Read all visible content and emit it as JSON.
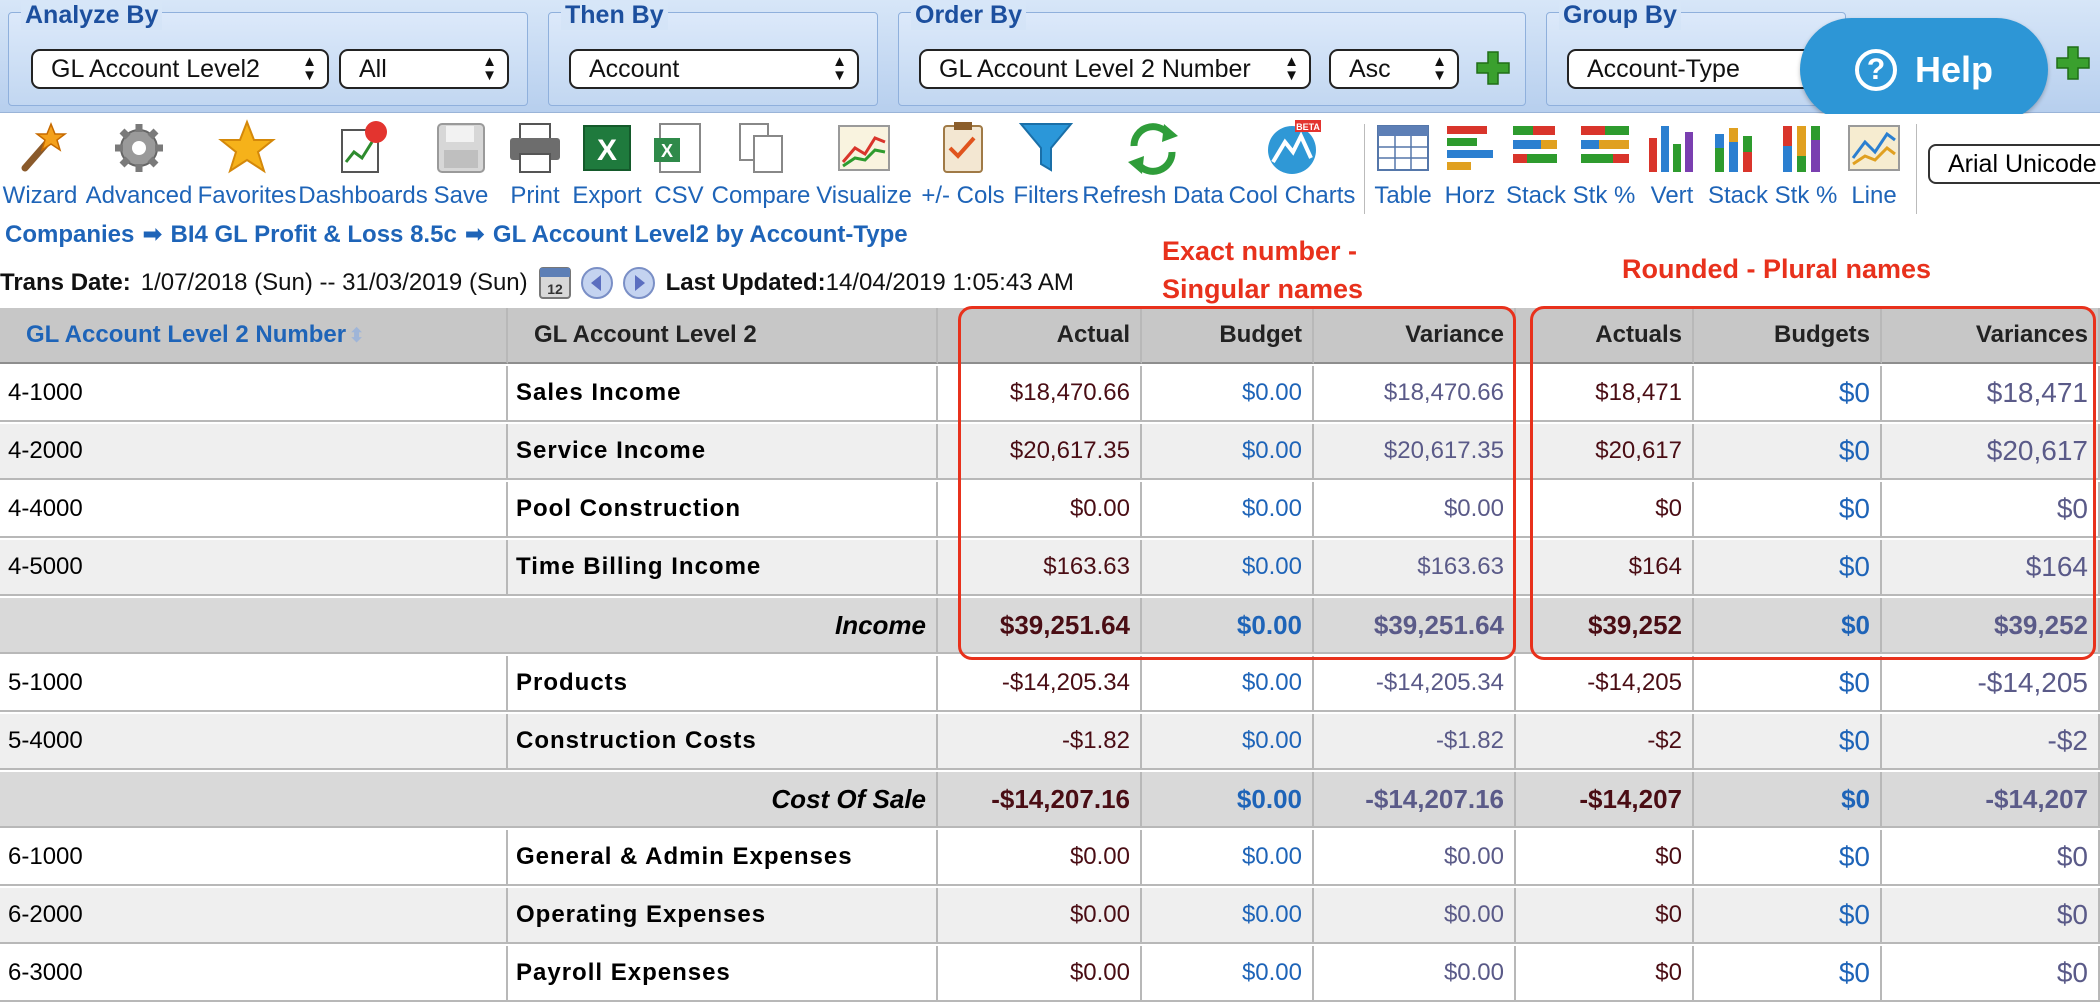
{
  "filters": {
    "analyze_by": {
      "label": "Analyze By",
      "select1": "GL Account Level2",
      "select2": "All"
    },
    "then_by": {
      "label": "Then By",
      "select1": "Account"
    },
    "order_by": {
      "label": "Order By",
      "select1": "GL Account Level 2 Number",
      "select2": "Asc"
    },
    "group_by": {
      "label": "Group By",
      "select1": "Account-Type"
    }
  },
  "help": {
    "label": "Help",
    "icon": "question-circle-icon"
  },
  "toolbar": [
    {
      "label": "Wizard",
      "icon": "magic-wand-icon"
    },
    {
      "label": "Advanced",
      "icon": "gear-icon"
    },
    {
      "label": "Favorites",
      "icon": "star-icon"
    },
    {
      "label": "Dashboards",
      "icon": "dashboard-icon"
    },
    {
      "label": "Save",
      "icon": "save-disk-icon"
    },
    {
      "label": "Print",
      "icon": "printer-icon"
    },
    {
      "label": "Export",
      "icon": "excel-export-icon"
    },
    {
      "label": "CSV",
      "icon": "csv-icon"
    },
    {
      "label": "Compare",
      "icon": "compare-icon"
    },
    {
      "label": "Visualize",
      "icon": "visualize-chart-icon"
    },
    {
      "label": "+/- Cols",
      "icon": "columns-clipboard-icon"
    },
    {
      "label": "Filters",
      "icon": "funnel-icon"
    },
    {
      "label": "Refresh Data",
      "icon": "refresh-icon"
    },
    {
      "label": "Cool Charts",
      "icon": "cool-charts-icon",
      "badge": "BETA"
    },
    {
      "label": "Table",
      "icon": "table-icon"
    },
    {
      "label": "Horz",
      "icon": "horizontal-bar-icon"
    },
    {
      "label": "Stack",
      "icon": "stacked-horizontal-bar-icon"
    },
    {
      "label": "Stk %",
      "icon": "stacked-percent-horizontal-icon"
    },
    {
      "label": "Vert",
      "icon": "vertical-bar-icon"
    },
    {
      "label": "Stack",
      "icon": "stacked-vertical-bar-icon"
    },
    {
      "label": "Stk %",
      "icon": "stacked-percent-vertical-icon"
    },
    {
      "label": "Line",
      "icon": "line-chart-icon"
    }
  ],
  "font_select": "Arial Unicode",
  "breadcrumb": [
    "Companies",
    "BI4 GL Profit & Loss 8.5c",
    "GL Account Level2 by Account-Type"
  ],
  "info": {
    "trans_label": "Trans Date:",
    "trans_value": "1/07/2018 (Sun) -- 31/03/2019 (Sun)",
    "updated_label": "Last Updated:",
    "updated_value": "14/04/2019 1:05:43 AM"
  },
  "annotations": {
    "exact_line1": "Exact number -",
    "exact_line2": "Singular names",
    "rounded": "Rounded - Plural names"
  },
  "table": {
    "headers": [
      "GL Account Level 2 Number",
      "GL Account Level 2",
      "Actual",
      "Budget",
      "Variance",
      "Actuals",
      "Budgets",
      "Variances"
    ],
    "rows": [
      {
        "type": "data",
        "num": "4-1000",
        "name": "Sales Income",
        "actual": "$18,470.66",
        "budget": "$0.00",
        "variance": "$18,470.66",
        "actuals": "$18,471",
        "budgets": "$0",
        "variances": "$18,471"
      },
      {
        "type": "data",
        "num": "4-2000",
        "name": "Service Income",
        "actual": "$20,617.35",
        "budget": "$0.00",
        "variance": "$20,617.35",
        "actuals": "$20,617",
        "budgets": "$0",
        "variances": "$20,617"
      },
      {
        "type": "data",
        "num": "4-4000",
        "name": "Pool Construction",
        "actual": "$0.00",
        "budget": "$0.00",
        "variance": "$0.00",
        "actuals": "$0",
        "budgets": "$0",
        "variances": "$0"
      },
      {
        "type": "data",
        "num": "4-5000",
        "name": "Time Billing Income",
        "actual": "$163.63",
        "budget": "$0.00",
        "variance": "$163.63",
        "actuals": "$164",
        "budgets": "$0",
        "variances": "$164"
      },
      {
        "type": "subtotal",
        "label": "Income",
        "actual": "$39,251.64",
        "budget": "$0.00",
        "variance": "$39,251.64",
        "actuals": "$39,252",
        "budgets": "$0",
        "variances": "$39,252"
      },
      {
        "type": "data",
        "num": "5-1000",
        "name": "Products",
        "actual": "-$14,205.34",
        "budget": "$0.00",
        "variance": "-$14,205.34",
        "actuals": "-$14,205",
        "budgets": "$0",
        "variances": "-$14,205"
      },
      {
        "type": "data",
        "num": "5-4000",
        "name": "Construction Costs",
        "actual": "-$1.82",
        "budget": "$0.00",
        "variance": "-$1.82",
        "actuals": "-$2",
        "budgets": "$0",
        "variances": "-$2"
      },
      {
        "type": "subtotal",
        "label": "Cost Of Sale",
        "actual": "-$14,207.16",
        "budget": "$0.00",
        "variance": "-$14,207.16",
        "actuals": "-$14,207",
        "budgets": "$0",
        "variances": "-$14,207"
      },
      {
        "type": "data",
        "num": "6-1000",
        "name": "General & Admin Expenses",
        "actual": "$0.00",
        "budget": "$0.00",
        "variance": "$0.00",
        "actuals": "$0",
        "budgets": "$0",
        "variances": "$0"
      },
      {
        "type": "data",
        "num": "6-2000",
        "name": "Operating Expenses",
        "actual": "$0.00",
        "budget": "$0.00",
        "variance": "$0.00",
        "actuals": "$0",
        "budgets": "$0",
        "variances": "$0"
      },
      {
        "type": "data",
        "num": "6-3000",
        "name": "Payroll Expenses",
        "actual": "$0.00",
        "budget": "$0.00",
        "variance": "$0.00",
        "actuals": "$0",
        "budgets": "$0",
        "variances": "$0"
      }
    ]
  },
  "colors": {
    "accent": "#1e64b8",
    "annotation": "#e8311c",
    "help": "#2d96d6",
    "actual": "#4a0d14",
    "variance": "#5a5a88"
  }
}
